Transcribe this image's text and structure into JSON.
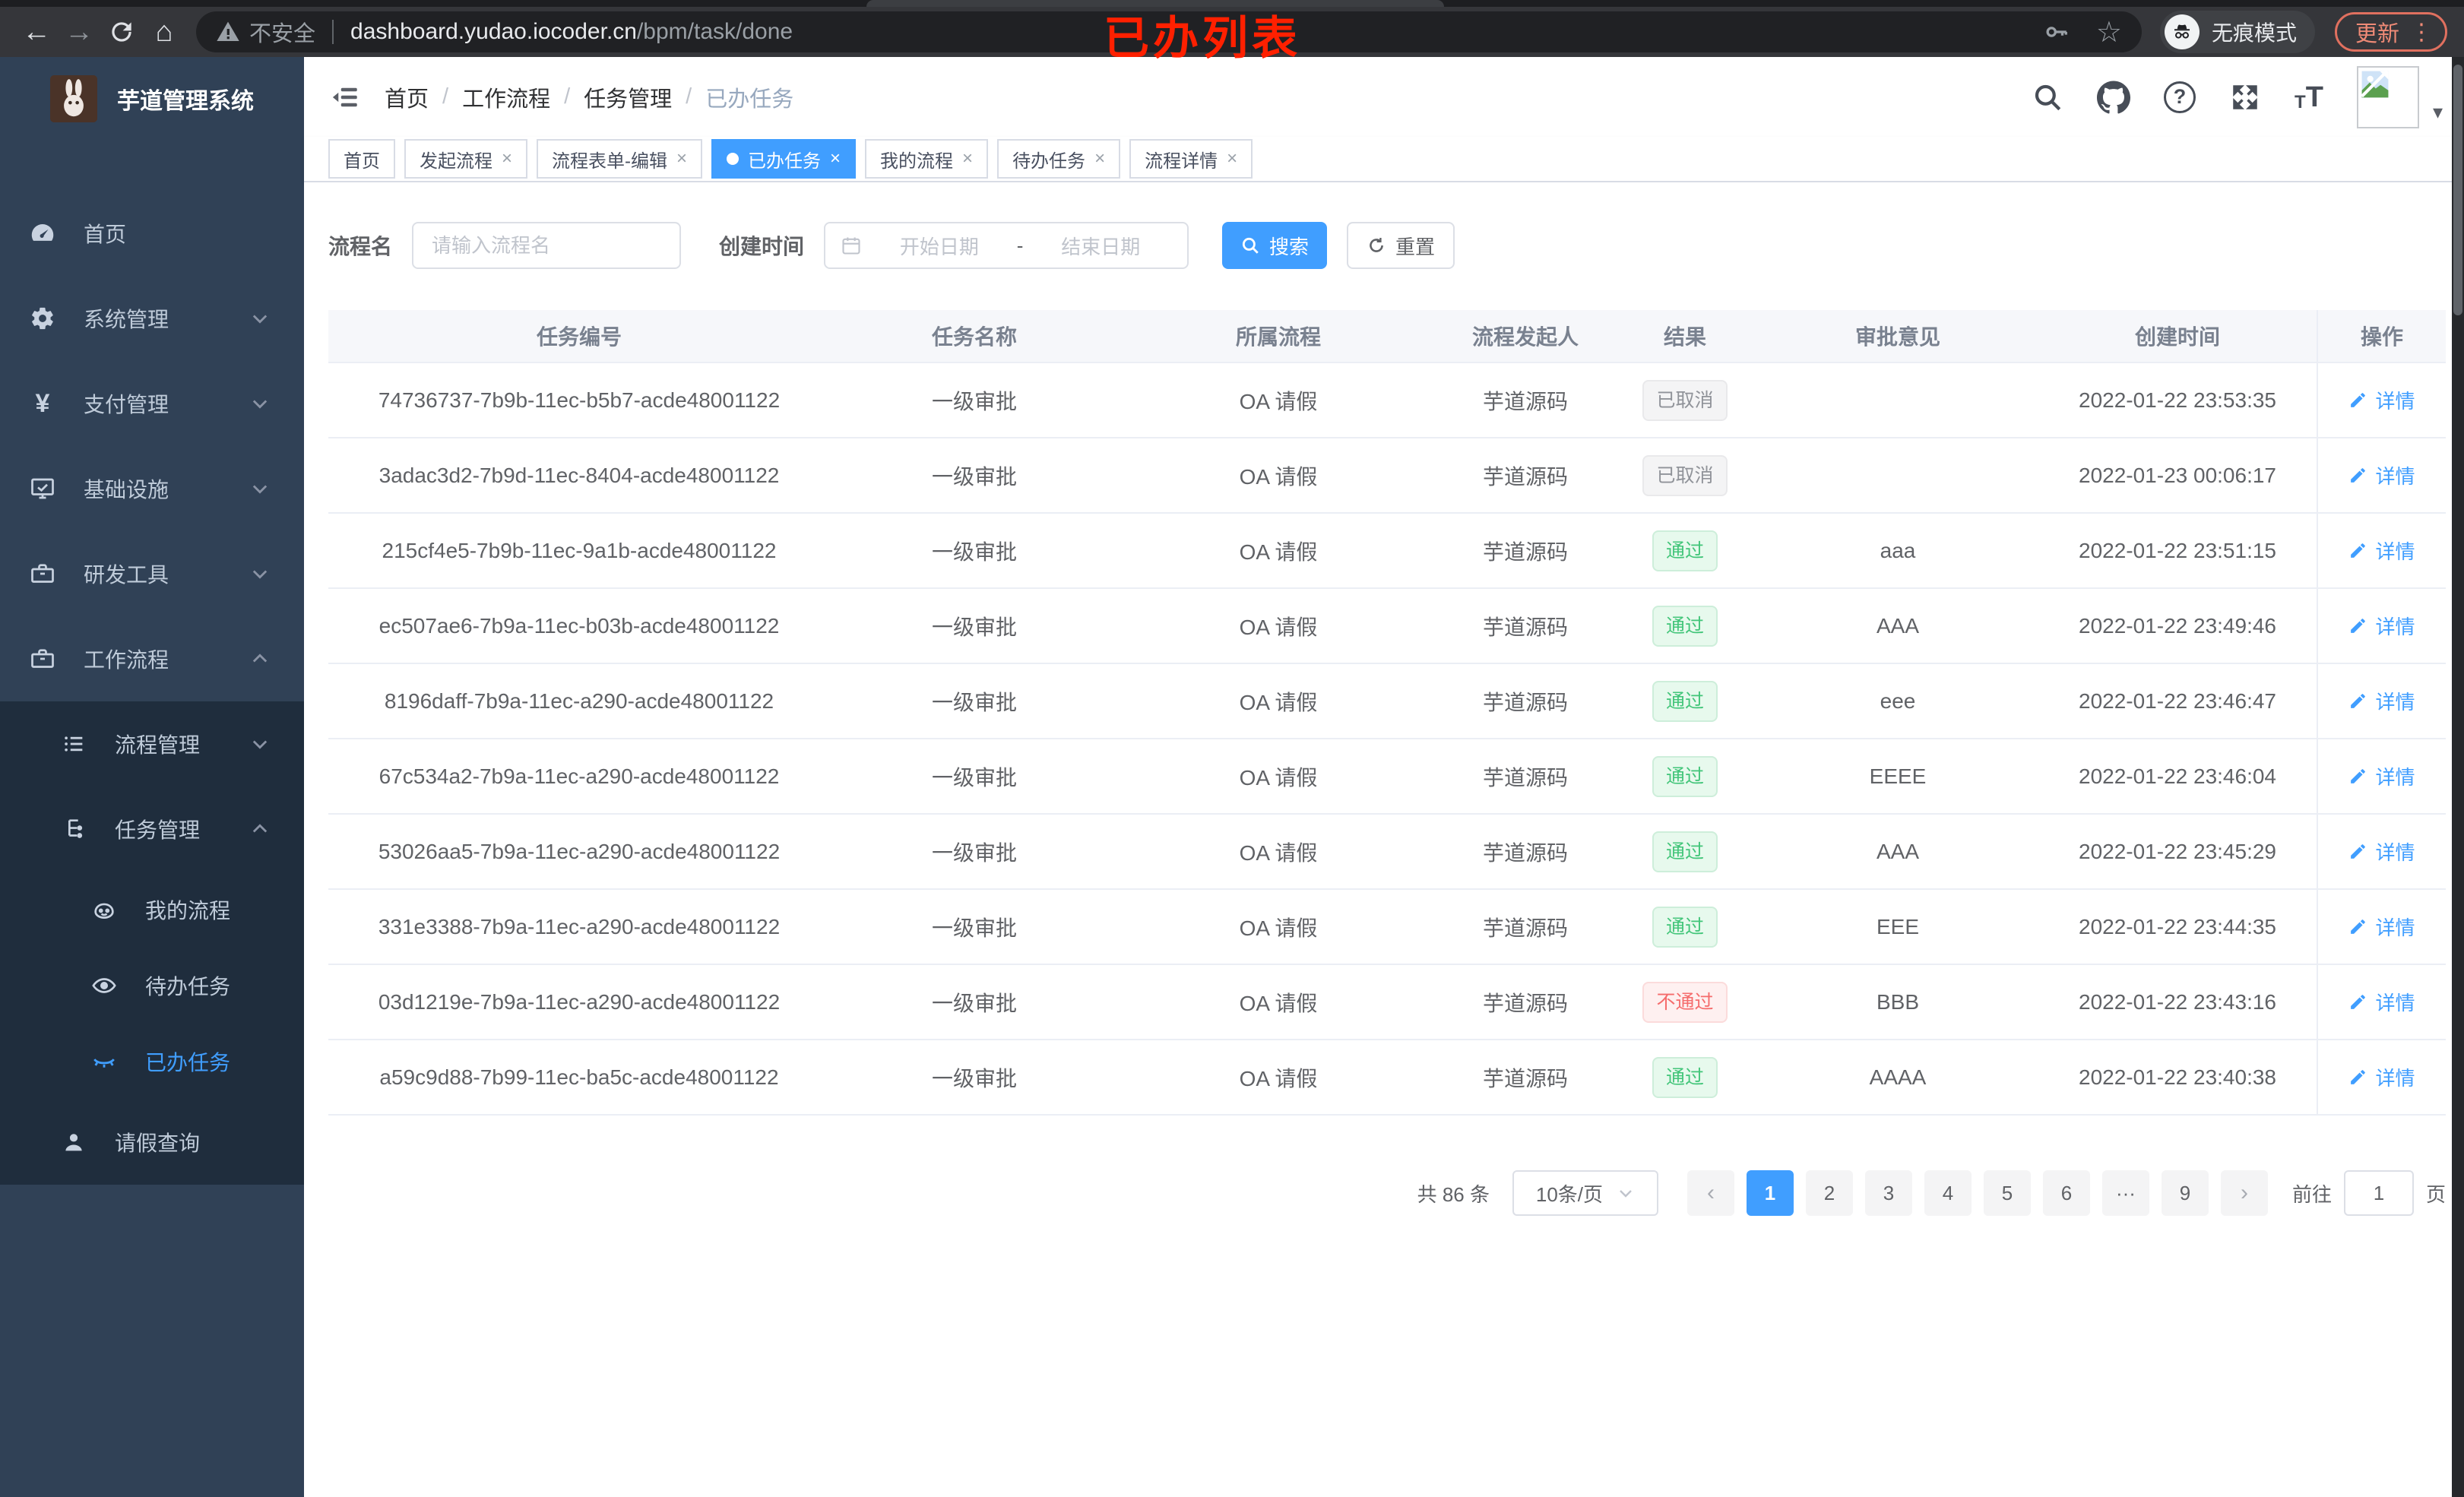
{
  "icons": {
    "back": "←",
    "forward": "→",
    "home": "⌂",
    "star": "☆",
    "close": "×",
    "help": "?",
    "menu_dots": "⋮",
    "caret_down": "▾",
    "yen": "¥",
    "prev": "‹",
    "next": "›",
    "breadcrumb_separator": "/",
    "range_separator": "-"
  },
  "browser": {
    "security_label": "不安全",
    "url_host": "dashboard.yudao.iocoder.cn",
    "url_path": "/bpm/task/done",
    "incognito_label": "无痕模式",
    "update_label": "更新",
    "annotation": "已办列表"
  },
  "sidebar": {
    "app_title": "芋道管理系统",
    "items": [
      {
        "label": "首页"
      },
      {
        "label": "系统管理"
      },
      {
        "label": "支付管理"
      },
      {
        "label": "基础设施"
      },
      {
        "label": "研发工具"
      },
      {
        "label": "工作流程"
      }
    ],
    "workflow_children": [
      {
        "label": "流程管理"
      },
      {
        "label": "任务管理"
      },
      {
        "label": "请假查询"
      }
    ],
    "task_children": [
      {
        "label": "我的流程"
      },
      {
        "label": "待办任务"
      },
      {
        "label": "已办任务"
      }
    ]
  },
  "navbar": {
    "breadcrumb": [
      "首页",
      "工作流程",
      "任务管理",
      "已办任务"
    ]
  },
  "tabs": [
    {
      "label": "首页",
      "closable": false,
      "active": false
    },
    {
      "label": "发起流程",
      "closable": true,
      "active": false
    },
    {
      "label": "流程表单-编辑",
      "closable": true,
      "active": false
    },
    {
      "label": "已办任务",
      "closable": true,
      "active": true
    },
    {
      "label": "我的流程",
      "closable": true,
      "active": false
    },
    {
      "label": "待办任务",
      "closable": true,
      "active": false
    },
    {
      "label": "流程详情",
      "closable": true,
      "active": false
    }
  ],
  "filters": {
    "name_label": "流程名",
    "name_placeholder": "请输入流程名",
    "date_label": "创建时间",
    "date_start_placeholder": "开始日期",
    "date_end_placeholder": "结束日期",
    "search_label": "搜索",
    "reset_label": "重置"
  },
  "table": {
    "columns": [
      "任务编号",
      "任务名称",
      "所属流程",
      "流程发起人",
      "结果",
      "审批意见",
      "创建时间",
      "操作"
    ],
    "action_label": "详情",
    "rows": [
      {
        "id": "74736737-7b9b-11ec-b5b7-acde48001122",
        "name": "一级审批",
        "process": "OA 请假",
        "starter": "芋道源码",
        "result": "已取消",
        "result_type": "info",
        "comment": "",
        "time": "2022-01-22 23:53:35"
      },
      {
        "id": "3adac3d2-7b9d-11ec-8404-acde48001122",
        "name": "一级审批",
        "process": "OA 请假",
        "starter": "芋道源码",
        "result": "已取消",
        "result_type": "info",
        "comment": "",
        "time": "2022-01-23 00:06:17"
      },
      {
        "id": "215cf4e5-7b9b-11ec-9a1b-acde48001122",
        "name": "一级审批",
        "process": "OA 请假",
        "starter": "芋道源码",
        "result": "通过",
        "result_type": "success",
        "comment": "aaa",
        "time": "2022-01-22 23:51:15"
      },
      {
        "id": "ec507ae6-7b9a-11ec-b03b-acde48001122",
        "name": "一级审批",
        "process": "OA 请假",
        "starter": "芋道源码",
        "result": "通过",
        "result_type": "success",
        "comment": "AAA",
        "time": "2022-01-22 23:49:46"
      },
      {
        "id": "8196daff-7b9a-11ec-a290-acde48001122",
        "name": "一级审批",
        "process": "OA 请假",
        "starter": "芋道源码",
        "result": "通过",
        "result_type": "success",
        "comment": "eee",
        "time": "2022-01-22 23:46:47"
      },
      {
        "id": "67c534a2-7b9a-11ec-a290-acde48001122",
        "name": "一级审批",
        "process": "OA 请假",
        "starter": "芋道源码",
        "result": "通过",
        "result_type": "success",
        "comment": "EEEE",
        "time": "2022-01-22 23:46:04"
      },
      {
        "id": "53026aa5-7b9a-11ec-a290-acde48001122",
        "name": "一级审批",
        "process": "OA 请假",
        "starter": "芋道源码",
        "result": "通过",
        "result_type": "success",
        "comment": "AAA",
        "time": "2022-01-22 23:45:29"
      },
      {
        "id": "331e3388-7b9a-11ec-a290-acde48001122",
        "name": "一级审批",
        "process": "OA 请假",
        "starter": "芋道源码",
        "result": "通过",
        "result_type": "success",
        "comment": "EEE",
        "time": "2022-01-22 23:44:35"
      },
      {
        "id": "03d1219e-7b9a-11ec-a290-acde48001122",
        "name": "一级审批",
        "process": "OA 请假",
        "starter": "芋道源码",
        "result": "不通过",
        "result_type": "danger",
        "comment": "BBB",
        "time": "2022-01-22 23:43:16"
      },
      {
        "id": "a59c9d88-7b99-11ec-ba5c-acde48001122",
        "name": "一级审批",
        "process": "OA 请假",
        "starter": "芋道源码",
        "result": "通过",
        "result_type": "success",
        "comment": "AAAA",
        "time": "2022-01-22 23:40:38"
      }
    ]
  },
  "pagination": {
    "total_label": "共 86 条",
    "page_size": "10条/页",
    "pages": [
      {
        "label": "1",
        "active": true
      },
      {
        "label": "2"
      },
      {
        "label": "3"
      },
      {
        "label": "4"
      },
      {
        "label": "5"
      },
      {
        "label": "6"
      },
      {
        "label": "···",
        "ellipsis": true
      },
      {
        "label": "9"
      }
    ],
    "goto_label": "前往",
    "page_unit": "页",
    "jumper_value": "1"
  },
  "colors": {
    "primary": "#409eff",
    "sidebar_bg": "#304156",
    "submenu_bg": "#1f2d3d",
    "success": "#42c579",
    "danger": "#f56c6c",
    "info": "#909399",
    "annotation": "#ff2000"
  }
}
